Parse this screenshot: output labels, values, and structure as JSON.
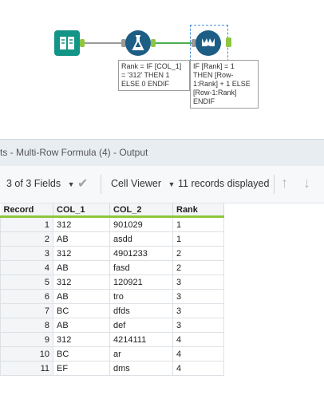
{
  "canvas": {
    "formula_annotation": [
      "Rank = IF [COL_1]",
      "= '312' THEN 1",
      "ELSE 0 ENDIF"
    ],
    "multirow_annotation": [
      "IF [Rank] = 1",
      "THEN [Row-",
      "1:Rank] + 1 ELSE",
      "[Row-1:Rank]",
      "ENDIF"
    ]
  },
  "output": {
    "title": "ts - Multi-Row Formula (4) - Output",
    "fields_label": "3 of 3 Fields",
    "cell_viewer_label": "Cell Viewer",
    "records_label": "11 records displayed"
  },
  "table": {
    "headers": [
      "Record",
      "COL_1",
      "COL_2",
      "Rank"
    ],
    "rows": [
      [
        "1",
        "312",
        "901029",
        "1"
      ],
      [
        "2",
        "AB",
        "asdd",
        "1"
      ],
      [
        "3",
        "312",
        "4901233",
        "2"
      ],
      [
        "4",
        "AB",
        "fasd",
        "2"
      ],
      [
        "5",
        "312",
        "120921",
        "3"
      ],
      [
        "6",
        "AB",
        "tro",
        "3"
      ],
      [
        "7",
        "BC",
        "dfds",
        "3"
      ],
      [
        "8",
        "AB",
        "def",
        "3"
      ],
      [
        "9",
        "312",
        "4214111",
        "4"
      ],
      [
        "10",
        "BC",
        "ar",
        "4"
      ],
      [
        "11",
        "EF",
        "dms",
        "4"
      ]
    ]
  }
}
